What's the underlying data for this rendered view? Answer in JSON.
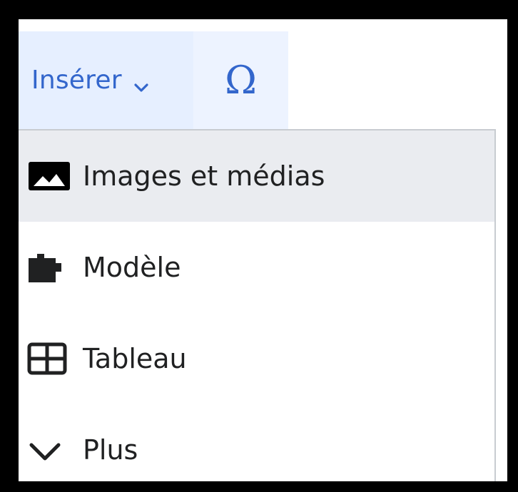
{
  "toolbar": {
    "insert_label": "Insérer",
    "insert_icon": "chevron-down-icon",
    "special_char_label": "Ω",
    "accent_color": "#3366cc"
  },
  "menu": {
    "items": [
      {
        "label": "Images et médias",
        "icon": "image-icon",
        "highlighted": true
      },
      {
        "label": "Modèle",
        "icon": "puzzle-icon",
        "highlighted": false
      },
      {
        "label": "Tableau",
        "icon": "table-icon",
        "highlighted": false
      },
      {
        "label": "Plus",
        "icon": "chevron-down-icon",
        "highlighted": false
      }
    ]
  }
}
